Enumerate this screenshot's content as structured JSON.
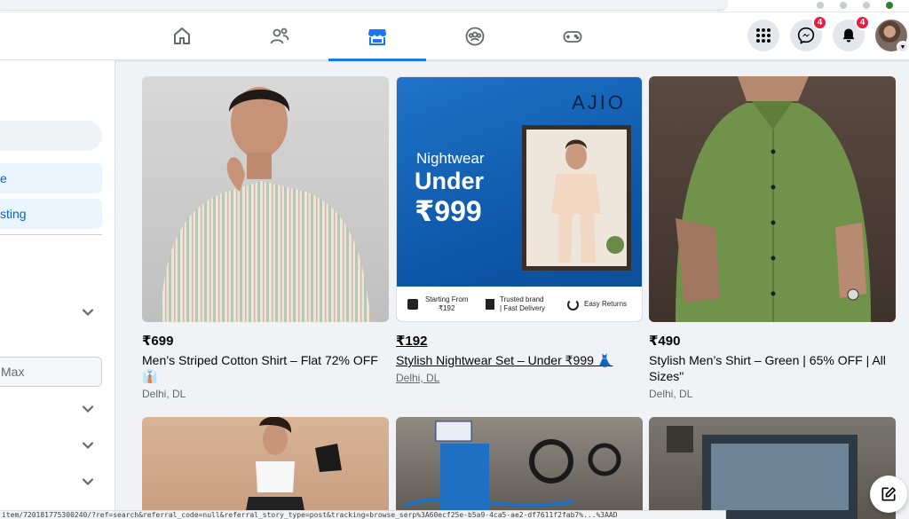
{
  "header": {
    "nav": [
      {
        "name": "home-icon",
        "active": false
      },
      {
        "name": "friends-icon",
        "active": false
      },
      {
        "name": "marketplace-icon",
        "active": true
      },
      {
        "name": "groups-icon",
        "active": false
      },
      {
        "name": "gaming-icon",
        "active": false
      }
    ],
    "messenger_badge": "4",
    "notifications_badge": "4"
  },
  "sidebar": {
    "btn1_label": "e",
    "btn2_label": "sting",
    "max_placeholder": "Max"
  },
  "products": [
    {
      "price": "₹699",
      "title": "Men’s Striped Cotton Shirt – Flat 72% OFF 👔",
      "location": "Delhi, DL"
    },
    {
      "price": "₹192",
      "title": "Stylish Nightwear Set – Under ₹999 👗",
      "location": "Delhi, DL"
    },
    {
      "price": "₹490",
      "title": "Stylish Men’s Shirt – Green | 65% OFF | All Sizes\"",
      "location": "Delhi, DL"
    }
  ],
  "ajio_ad": {
    "brand": "AJIO",
    "line1": "Nightwear",
    "line2": "Under",
    "line3": "₹999",
    "strip1a": "Starting From",
    "strip1b": "₹192",
    "strip2a": "Trusted brand",
    "strip2b": "| Fast Delivery",
    "strip3": "Easy Returns"
  },
  "statusbar": {
    "url": "item/720181775300240/?ref=search&referral_code=null&referral_story_type=post&tracking=browse_serp%3A60ecf25e-b5a9-4ca5-ae2-df7611f2fab7%...%3AAD"
  },
  "colors": {
    "accent": "#1877f2",
    "badge": "#e41e3f"
  }
}
